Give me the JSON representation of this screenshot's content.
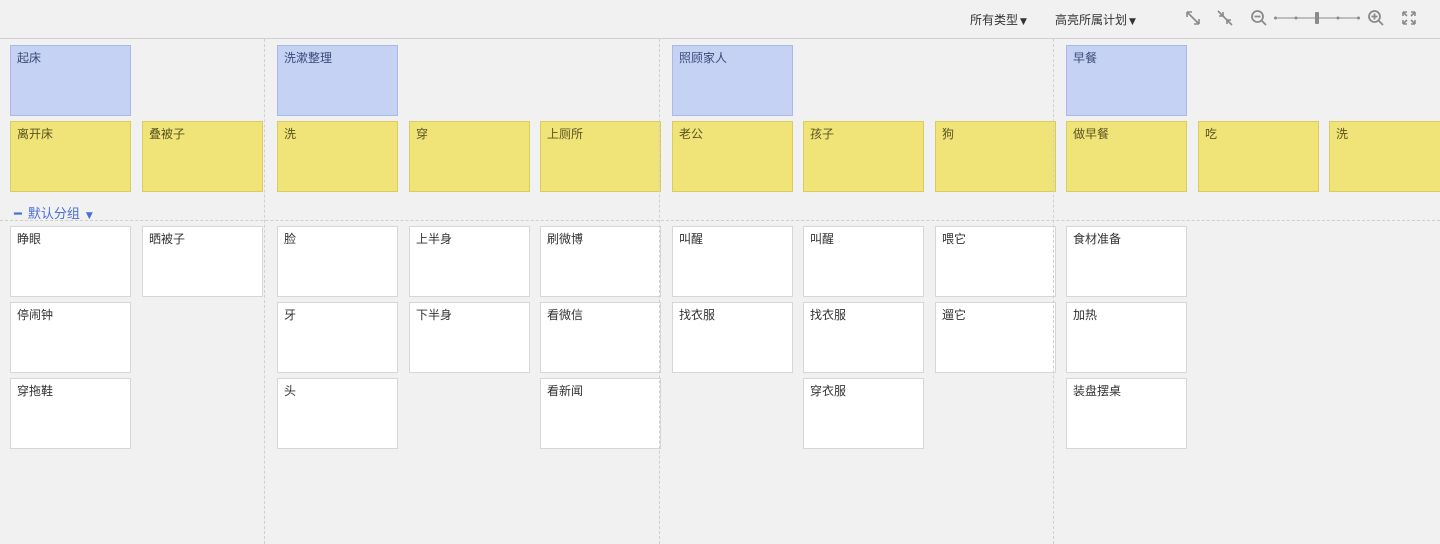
{
  "toolbar": {
    "type_filter": "所有类型",
    "highlight_filter": "高亮所属计划",
    "icons": [
      "expand-icon",
      "collapse-icon",
      "zoom-out-icon",
      "zoom-slider",
      "zoom-in-icon",
      "fullscreen-icon"
    ]
  },
  "group": {
    "label": "默认分组"
  },
  "activities": [
    {
      "title": "起床",
      "steps": [
        {
          "title": "离开床",
          "stories": [
            "睁眼",
            "停闹钟",
            "穿拖鞋"
          ]
        },
        {
          "title": "叠被子",
          "stories": [
            "晒被子"
          ]
        }
      ]
    },
    {
      "title": "洗漱整理",
      "steps": [
        {
          "title": "洗",
          "stories": [
            "脸",
            "牙",
            "头"
          ]
        },
        {
          "title": "穿",
          "stories": [
            "上半身",
            "下半身"
          ]
        },
        {
          "title": "上厕所",
          "stories": [
            "刷微博",
            "看微信",
            "看新闻"
          ]
        }
      ]
    },
    {
      "title": "照顾家人",
      "steps": [
        {
          "title": "老公",
          "stories": [
            "叫醒",
            "找衣服"
          ]
        },
        {
          "title": "孩子",
          "stories": [
            "叫醒",
            "找衣服",
            "穿衣服"
          ]
        },
        {
          "title": "狗",
          "stories": [
            "喂它",
            "遛它"
          ]
        }
      ]
    },
    {
      "title": "早餐",
      "steps": [
        {
          "title": "做早餐",
          "stories": [
            "食材准备",
            "加热",
            "装盘摆桌"
          ]
        },
        {
          "title": "吃",
          "stories": []
        },
        {
          "title": "洗",
          "stories": []
        }
      ]
    }
  ]
}
